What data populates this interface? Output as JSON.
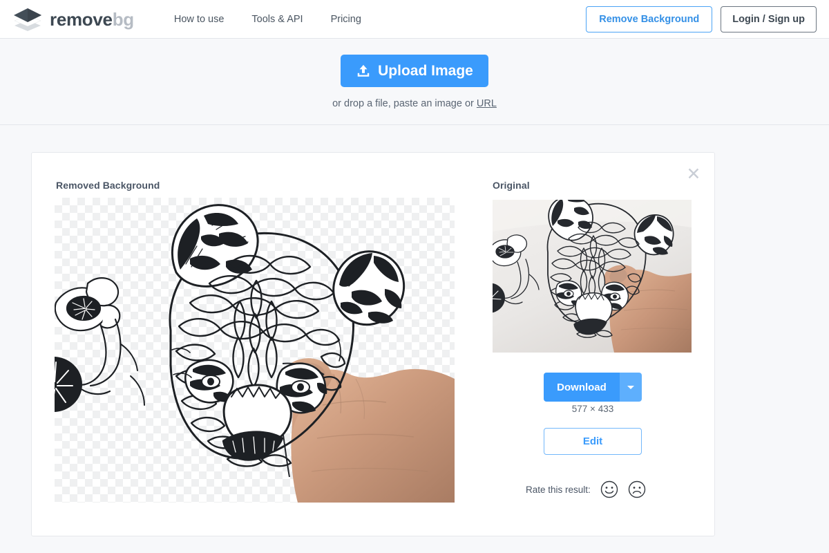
{
  "header": {
    "logo_icon": "stacked-diamond-logo",
    "brand_primary": "remove",
    "brand_secondary": "bg",
    "nav": [
      {
        "label": "How to use"
      },
      {
        "label": "Tools & API"
      },
      {
        "label": "Pricing"
      }
    ],
    "remove_background_label": "Remove Background",
    "login_label": "Login / Sign up"
  },
  "upload": {
    "button_label": "Upload Image",
    "icon": "upload-icon",
    "hint_prefix": "or drop a file, paste an image or ",
    "hint_link": "URL"
  },
  "result": {
    "removed_label": "Removed Background",
    "original_label": "Original",
    "close_icon": "close-icon",
    "download_label": "Download",
    "download_caret_icon": "chevron-down-icon",
    "dimensions": "577 × 433",
    "edit_label": "Edit",
    "rate_label": "Rate this result:",
    "rate_positive_icon": "smiley-happy-icon",
    "rate_negative_icon": "smiley-sad-icon"
  },
  "colors": {
    "accent_blue": "#3a9bfc",
    "accent_blue_light": "#5eaffd",
    "page_background": "#f7f8fa",
    "card_background": "#ffffff",
    "text_dark": "#3d4852",
    "text_muted": "#5a6573",
    "brand_gray": "#b6bcc4",
    "checker_gray": "#eff0f1"
  }
}
